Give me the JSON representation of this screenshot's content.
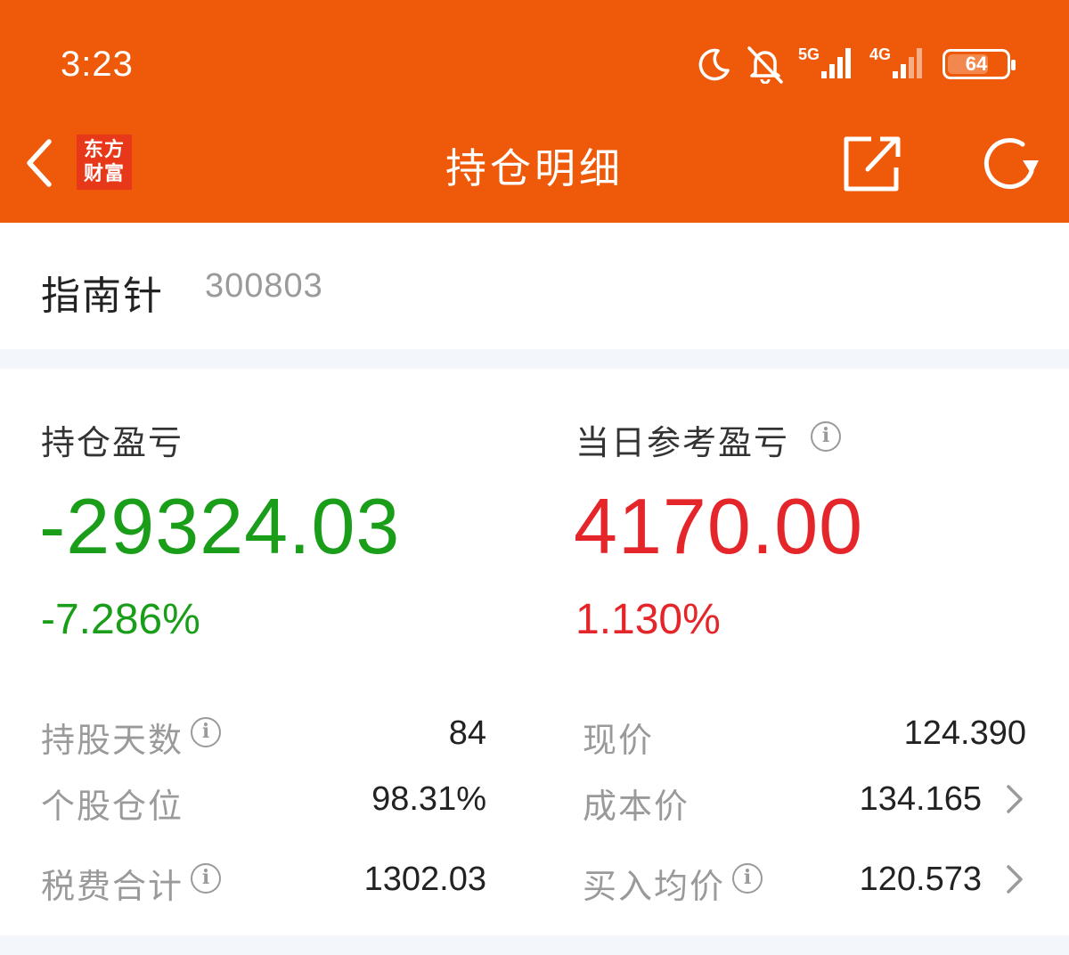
{
  "status_bar": {
    "time": "3:23",
    "icons": [
      "moon-icon",
      "bell-off-icon",
      "signal-5g-icon",
      "signal-4g-icon",
      "battery-icon"
    ],
    "net1": "5G",
    "net2": "4G",
    "battery": "64"
  },
  "nav": {
    "logo_line1": "东方",
    "logo_line2": "财富",
    "title": "持仓明细",
    "icons": [
      "chevron-left-icon",
      "share-icon",
      "refresh-icon"
    ]
  },
  "stock": {
    "name": "指南针",
    "code": "300803"
  },
  "summary": {
    "hold_pl_label": "持仓盈亏",
    "hold_pl_value": "-29324.03",
    "hold_pl_pct": "-7.286%",
    "day_pl_label": "当日参考盈亏",
    "day_pl_value": "4170.00",
    "day_pl_pct": "1.130%"
  },
  "details": {
    "left": [
      {
        "label": "持股天数",
        "value": "84",
        "info": true
      },
      {
        "label": "个股仓位",
        "value": "98.31%",
        "info": false
      },
      {
        "label": "税费合计",
        "value": "1302.03",
        "info": true
      }
    ],
    "right": [
      {
        "label": "现价",
        "value": "124.390",
        "info": false,
        "arrow": false
      },
      {
        "label": "成本价",
        "value": "134.165",
        "info": false,
        "arrow": true
      },
      {
        "label": "买入均价",
        "value": "120.573",
        "info": true,
        "arrow": true
      }
    ]
  },
  "colors": {
    "header": "#ef5a0a",
    "loss": "#1a9e1a",
    "gain": "#e4262b",
    "logo": "#e8381a"
  }
}
